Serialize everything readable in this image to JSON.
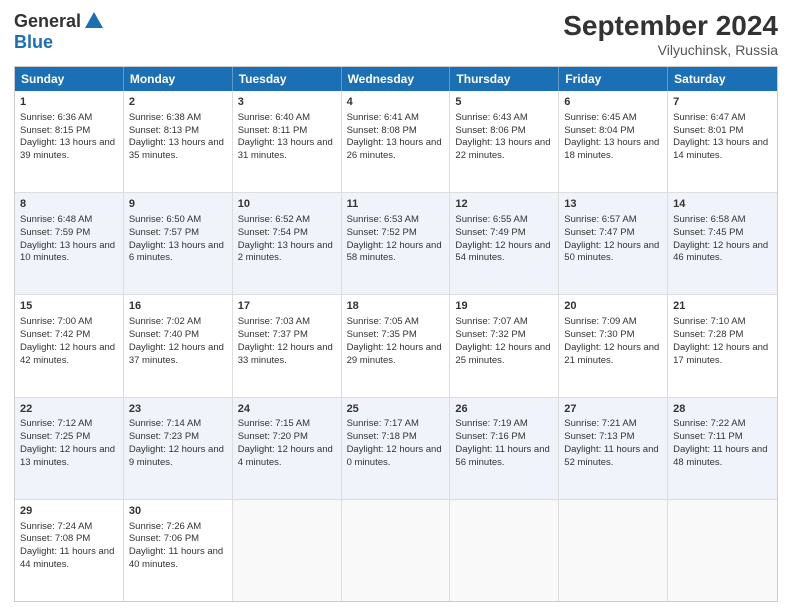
{
  "header": {
    "logo_general": "General",
    "logo_blue": "Blue",
    "month": "September 2024",
    "location": "Vilyuchinsk, Russia"
  },
  "days": [
    "Sunday",
    "Monday",
    "Tuesday",
    "Wednesday",
    "Thursday",
    "Friday",
    "Saturday"
  ],
  "rows": [
    [
      {
        "day": "1",
        "sunrise": "6:36 AM",
        "sunset": "8:15 PM",
        "daylight": "13 hours and 39 minutes."
      },
      {
        "day": "2",
        "sunrise": "6:38 AM",
        "sunset": "8:13 PM",
        "daylight": "13 hours and 35 minutes."
      },
      {
        "day": "3",
        "sunrise": "6:40 AM",
        "sunset": "8:11 PM",
        "daylight": "13 hours and 31 minutes."
      },
      {
        "day": "4",
        "sunrise": "6:41 AM",
        "sunset": "8:08 PM",
        "daylight": "13 hours and 26 minutes."
      },
      {
        "day": "5",
        "sunrise": "6:43 AM",
        "sunset": "8:06 PM",
        "daylight": "13 hours and 22 minutes."
      },
      {
        "day": "6",
        "sunrise": "6:45 AM",
        "sunset": "8:04 PM",
        "daylight": "13 hours and 18 minutes."
      },
      {
        "day": "7",
        "sunrise": "6:47 AM",
        "sunset": "8:01 PM",
        "daylight": "13 hours and 14 minutes."
      }
    ],
    [
      {
        "day": "8",
        "sunrise": "6:48 AM",
        "sunset": "7:59 PM",
        "daylight": "13 hours and 10 minutes."
      },
      {
        "day": "9",
        "sunrise": "6:50 AM",
        "sunset": "7:57 PM",
        "daylight": "13 hours and 6 minutes."
      },
      {
        "day": "10",
        "sunrise": "6:52 AM",
        "sunset": "7:54 PM",
        "daylight": "13 hours and 2 minutes."
      },
      {
        "day": "11",
        "sunrise": "6:53 AM",
        "sunset": "7:52 PM",
        "daylight": "12 hours and 58 minutes."
      },
      {
        "day": "12",
        "sunrise": "6:55 AM",
        "sunset": "7:49 PM",
        "daylight": "12 hours and 54 minutes."
      },
      {
        "day": "13",
        "sunrise": "6:57 AM",
        "sunset": "7:47 PM",
        "daylight": "12 hours and 50 minutes."
      },
      {
        "day": "14",
        "sunrise": "6:58 AM",
        "sunset": "7:45 PM",
        "daylight": "12 hours and 46 minutes."
      }
    ],
    [
      {
        "day": "15",
        "sunrise": "7:00 AM",
        "sunset": "7:42 PM",
        "daylight": "12 hours and 42 minutes."
      },
      {
        "day": "16",
        "sunrise": "7:02 AM",
        "sunset": "7:40 PM",
        "daylight": "12 hours and 37 minutes."
      },
      {
        "day": "17",
        "sunrise": "7:03 AM",
        "sunset": "7:37 PM",
        "daylight": "12 hours and 33 minutes."
      },
      {
        "day": "18",
        "sunrise": "7:05 AM",
        "sunset": "7:35 PM",
        "daylight": "12 hours and 29 minutes."
      },
      {
        "day": "19",
        "sunrise": "7:07 AM",
        "sunset": "7:32 PM",
        "daylight": "12 hours and 25 minutes."
      },
      {
        "day": "20",
        "sunrise": "7:09 AM",
        "sunset": "7:30 PM",
        "daylight": "12 hours and 21 minutes."
      },
      {
        "day": "21",
        "sunrise": "7:10 AM",
        "sunset": "7:28 PM",
        "daylight": "12 hours and 17 minutes."
      }
    ],
    [
      {
        "day": "22",
        "sunrise": "7:12 AM",
        "sunset": "7:25 PM",
        "daylight": "12 hours and 13 minutes."
      },
      {
        "day": "23",
        "sunrise": "7:14 AM",
        "sunset": "7:23 PM",
        "daylight": "12 hours and 9 minutes."
      },
      {
        "day": "24",
        "sunrise": "7:15 AM",
        "sunset": "7:20 PM",
        "daylight": "12 hours and 4 minutes."
      },
      {
        "day": "25",
        "sunrise": "7:17 AM",
        "sunset": "7:18 PM",
        "daylight": "12 hours and 0 minutes."
      },
      {
        "day": "26",
        "sunrise": "7:19 AM",
        "sunset": "7:16 PM",
        "daylight": "11 hours and 56 minutes."
      },
      {
        "day": "27",
        "sunrise": "7:21 AM",
        "sunset": "7:13 PM",
        "daylight": "11 hours and 52 minutes."
      },
      {
        "day": "28",
        "sunrise": "7:22 AM",
        "sunset": "7:11 PM",
        "daylight": "11 hours and 48 minutes."
      }
    ],
    [
      {
        "day": "29",
        "sunrise": "7:24 AM",
        "sunset": "7:08 PM",
        "daylight": "11 hours and 44 minutes."
      },
      {
        "day": "30",
        "sunrise": "7:26 AM",
        "sunset": "7:06 PM",
        "daylight": "11 hours and 40 minutes."
      },
      null,
      null,
      null,
      null,
      null
    ]
  ]
}
